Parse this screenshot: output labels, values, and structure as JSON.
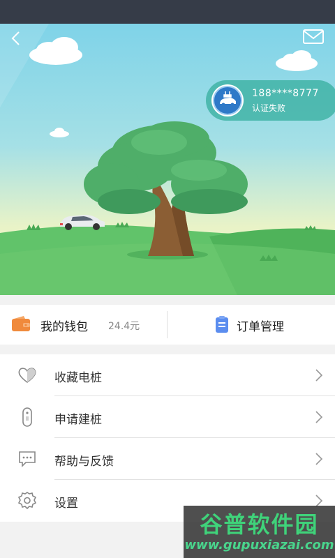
{
  "header": {
    "back_icon": "chevron-left-icon",
    "mail_icon": "mail-icon"
  },
  "user": {
    "phone": "188****8777",
    "status": "认证失败",
    "avatar_icon": "car-plug-icon"
  },
  "quick_actions": {
    "wallet_label": "我的钱包",
    "wallet_amount": "24.4元",
    "orders_label": "订单管理"
  },
  "menu": {
    "items": [
      {
        "label": "收藏电桩",
        "icon": "heart-icon"
      },
      {
        "label": "申请建桩",
        "icon": "charger-pile-icon"
      },
      {
        "label": "帮助与反馈",
        "icon": "chat-bubble-icon"
      },
      {
        "label": "设置",
        "icon": "gear-icon"
      }
    ]
  },
  "watermark": {
    "title": "谷普软件园",
    "url": "www.gupuxiazai.com"
  },
  "colors": {
    "status_bar": "#363c48",
    "accent_orange": "#f08a3c",
    "accent_blue": "#5b8def",
    "card_teal": "#3aafa0"
  }
}
